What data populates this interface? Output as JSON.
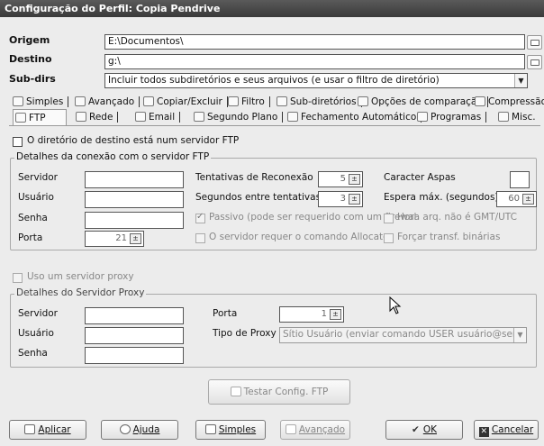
{
  "window": {
    "title": "Configuração do Perfil: Copia Pendrive"
  },
  "paths": {
    "origem_label": "Origem",
    "origem_value": "E:\\Documentos\\",
    "destino_label": "Destino",
    "destino_value": "g:\\",
    "subdirs_label": "Sub-dirs",
    "subdirs_value": "Incluir todos subdiretórios e seus arquivos (e usar o filtro de diretório)"
  },
  "tabs_row1": [
    "Simples",
    "Avançado",
    "Copiar/Excluir",
    "Filtro",
    "Sub-diretórios",
    "Opções de comparação",
    "Compressão"
  ],
  "tabs_row2": [
    "FTP",
    "Rede",
    "Email",
    "Segundo Plano",
    "Fechamento Automático",
    "Programas",
    "Misc."
  ],
  "ftp": {
    "dest_is_ftp_label": "O diretório de destino está num servidor FTP",
    "conn_group_title": "Detalhes da conexão com o servidor FTP",
    "server_label": "Servidor",
    "user_label": "Usuário",
    "password_label": "Senha",
    "port_label": "Porta",
    "port_value": "21",
    "retries_label": "Tentativas de Reconexão",
    "retries_value": "5",
    "seconds_label": "Segundos entre tentativas",
    "seconds_value": "3",
    "quote_char_label": "Caracter Aspas",
    "max_wait_label": "Espera máx. (segundos)",
    "max_wait_value": "60",
    "passive_label": "Passivo (pode ser requerido com um firewal",
    "passive_checked": true,
    "gmt_label": "Hora arq. não é GMT/UTC",
    "allocate_label": "O servidor requer o comando Allocate",
    "binary_label": "Forçar transf. binárias"
  },
  "proxy": {
    "use_proxy_label": "Uso um servidor proxy",
    "group_title": "Detalhes do Servidor Proxy",
    "server_label": "Servidor",
    "user_label": "Usuário",
    "password_label": "Senha",
    "port_label": "Porta",
    "port_value": "1",
    "type_label": "Tipo de Proxy",
    "type_value": "Sítio Usuário (enviar comando USER usuário@servidor)"
  },
  "test_button": "Testar Config. FTP",
  "bottom": {
    "apply": "Aplicar",
    "help": "Ajuda",
    "simple": "Simples",
    "advanced": "Avançado",
    "ok": "OK",
    "cancel": "Cancelar"
  }
}
